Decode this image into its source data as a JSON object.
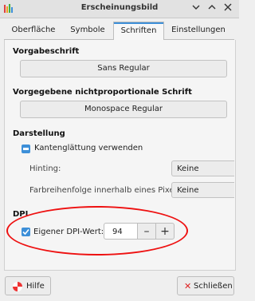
{
  "window": {
    "title": "Erscheinungsbild"
  },
  "tabs": [
    {
      "label": "Oberfläche"
    },
    {
      "label": "Symbole"
    },
    {
      "label": "Schriften"
    },
    {
      "label": "Einstellungen"
    }
  ],
  "active_tab": "Schriften",
  "fonts": {
    "default_title": "Vorgabeschrift",
    "default_value": "Sans Regular",
    "mono_title": "Vorgegebene nichtproportionale Schrift",
    "mono_value": "Monospace Regular"
  },
  "rendering": {
    "title": "Darstellung",
    "antialias_label": "Kantenglättung verwenden",
    "antialias_state": "indeterminate",
    "hinting_label": "Hinting:",
    "hinting_value": "Keine",
    "subpixel_label": "Farbreihenfolge innerhalb eines Pixels:",
    "subpixel_value": "Keine"
  },
  "dpi": {
    "title": "DPI",
    "custom_label": "Eigener DPI-Wert:",
    "custom_checked": true,
    "value": "94",
    "minus": "–",
    "plus": "+"
  },
  "footer": {
    "help_label": "Hilfe",
    "close_label": "Schließen"
  },
  "colors": {
    "accent": "#3d8fd8",
    "annotation": "#e11111"
  }
}
